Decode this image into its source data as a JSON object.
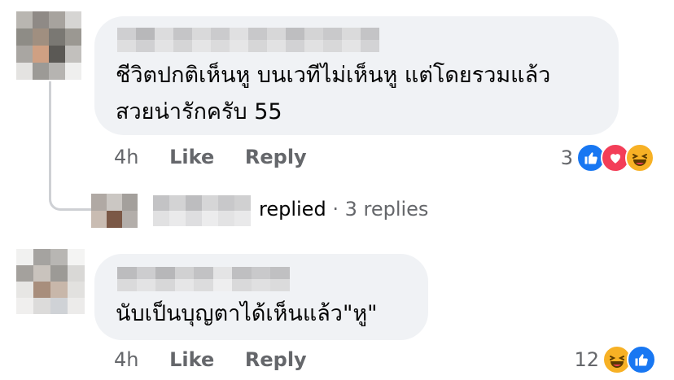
{
  "comments": [
    {
      "text_line1": "ชีวิตปกติเห็นหู บนเวทีไม่เห็นหู แต่โดยรวมแล้ว",
      "text_line2": "สวยน่ารักครับ 55",
      "time": "4h",
      "like_label": "Like",
      "reply_label": "Reply",
      "reaction_count": "3",
      "reactions": [
        "like-icon",
        "love-icon",
        "haha-icon"
      ]
    },
    {
      "text_line1": "นับเป็นบุญตาได้เห็นแล้ว\"หู\"",
      "time": "4h",
      "like_label": "Like",
      "reply_label": "Reply",
      "reaction_count": "12",
      "reactions": [
        "haha-icon",
        "like-icon"
      ]
    }
  ],
  "reply_summary": {
    "action": "replied",
    "separator": " · ",
    "count_label": "3 replies"
  },
  "colors": {
    "bubble": "#f0f2f5",
    "meta_text": "#65676b",
    "like_blue": "#1877f2",
    "love_red": "#f33e58",
    "haha_yellow": "#f7b125"
  }
}
